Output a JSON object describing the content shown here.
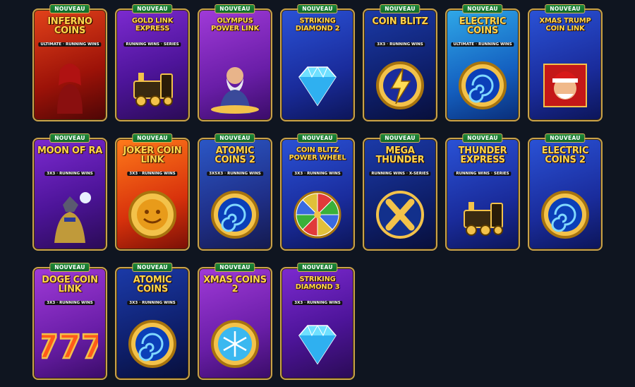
{
  "badge_label": "NOUVEAU",
  "games": [
    {
      "title": "INFERNO COINS",
      "subtitle": "ULTIMATE · RUNNING WINS",
      "theme": "red",
      "art": "woman-figure"
    },
    {
      "title": "GOLD LINK EXPRESS",
      "subtitle": "RUNNING WINS · SERIES",
      "theme": "purple",
      "art": "train-icon"
    },
    {
      "title": "OLYMPUS POWER LINK",
      "subtitle": "",
      "theme": "violet",
      "art": "zeus-figure"
    },
    {
      "title": "STRIKING DIAMOND 2",
      "subtitle": "",
      "theme": "blue",
      "art": "diamond-icon"
    },
    {
      "title": "COIN BLITZ",
      "subtitle": "3X3 · RUNNING WINS",
      "theme": "navy",
      "art": "lightning-coin-icon"
    },
    {
      "title": "ELECTRIC COINS",
      "subtitle": "ULTIMATE · RUNNING WINS",
      "theme": "sky",
      "art": "vortex-coin-icon"
    },
    {
      "title": "XMAS TRUMP COIN LINK",
      "subtitle": "",
      "theme": "blue",
      "art": "santa-figure"
    },
    {
      "title": "MOON OF RA",
      "subtitle": "3X3 · RUNNING WINS",
      "theme": "purple",
      "art": "ra-figure"
    },
    {
      "title": "JOKER COIN LINK",
      "subtitle": "3X3 · RUNNING WINS",
      "theme": "orange",
      "art": "joker-coin-icon"
    },
    {
      "title": "ATOMIC COINS 2",
      "subtitle": "3X5X3 · RUNNING WINS",
      "theme": "teal",
      "art": "vortex-coin-icon"
    },
    {
      "title": "COIN BLITZ POWER WHEEL",
      "subtitle": "3X3 · RUNNING WINS",
      "theme": "blue",
      "art": "wheel-icon"
    },
    {
      "title": "MEGA THUNDER",
      "subtitle": "RUNNING WINS · X-SERIES",
      "theme": "navy",
      "art": "x-coin-icon"
    },
    {
      "title": "THUNDER EXPRESS",
      "subtitle": "RUNNING WINS · SERIES",
      "theme": "blue",
      "art": "train-icon"
    },
    {
      "title": "ELECTRIC COINS 2",
      "subtitle": "",
      "theme": "blue",
      "art": "vortex-coin-icon"
    },
    {
      "title": "DOGE COIN LINK",
      "subtitle": "3X3 · RUNNING WINS",
      "theme": "violet",
      "art": "seven-icon"
    },
    {
      "title": "ATOMIC COINS",
      "subtitle": "3X3 · RUNNING WINS",
      "theme": "navy",
      "art": "vortex-coin-icon"
    },
    {
      "title": "XMAS COINS 2",
      "subtitle": "",
      "theme": "violet",
      "art": "snow-coin-icon"
    },
    {
      "title": "STRIKING DIAMOND 3",
      "subtitle": "3X3 · RUNNING WINS",
      "theme": "purple",
      "art": "diamond-icon"
    }
  ],
  "colors": {
    "background": "#0f1520",
    "badge": "#1f8a3a",
    "frame": "#c9a24a",
    "title": "#ffd54a"
  }
}
